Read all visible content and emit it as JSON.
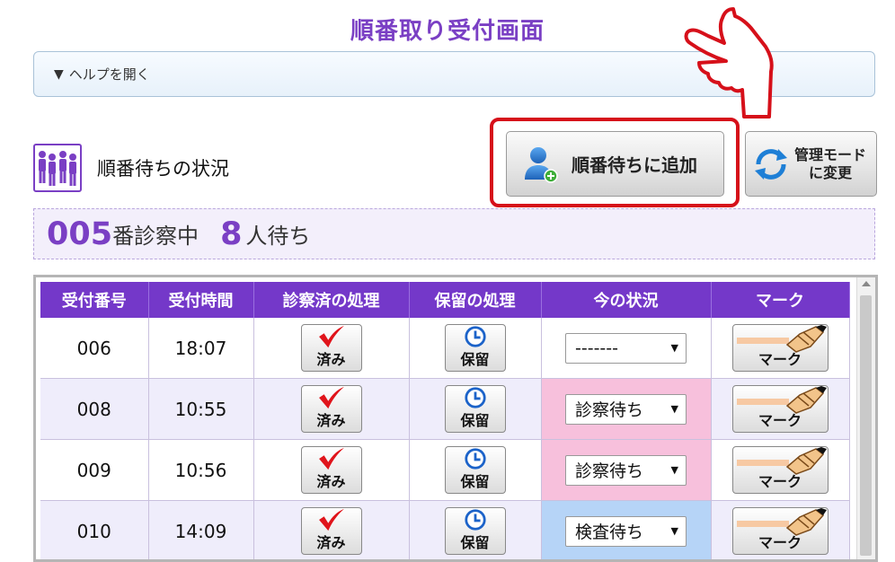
{
  "page": {
    "title": "順番取り受付画面"
  },
  "help": {
    "arrow": "▼",
    "label": "ヘルプを開く"
  },
  "status_section": {
    "label": "順番待ちの状況"
  },
  "toolbar": {
    "add_label": "順番待ちに追加",
    "admin_label_line1": "管理モード",
    "admin_label_line2": "に変更"
  },
  "now_serving": {
    "number": "005",
    "number_suffix": "番診察中",
    "waiting_count": "8",
    "waiting_suffix": "人待ち"
  },
  "table": {
    "headers": [
      "受付番号",
      "受付時間",
      "診察済の処理",
      "保留の処理",
      "今の状況",
      "マーク"
    ],
    "done_label": "済み",
    "hold_label": "保留",
    "mark_label": "マーク",
    "rows": [
      {
        "number": "006",
        "time": "18:07",
        "status": "-------",
        "status_color": ""
      },
      {
        "number": "008",
        "time": "10:55",
        "status": "診察待ち",
        "status_color": "#f7c0dc"
      },
      {
        "number": "009",
        "time": "10:56",
        "status": "診察待ち",
        "status_color": "#f7c0dc"
      },
      {
        "number": "010",
        "time": "14:09",
        "status": "検査待ち",
        "status_color": "#b6d4f7"
      }
    ]
  },
  "colors": {
    "accent": "#7438c9",
    "highlight": "#d6101a",
    "pink_status": "#f7c0dc",
    "blue_status": "#b6d4f7"
  }
}
